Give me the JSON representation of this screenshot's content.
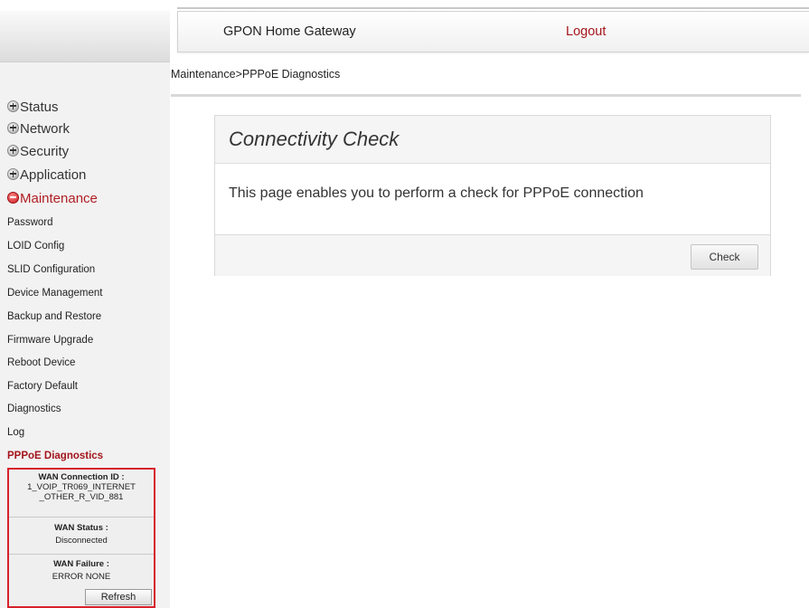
{
  "header": {
    "title": "GPON Home Gateway",
    "logout": "Logout"
  },
  "breadcrumb": "Maintenance>PPPoE Diagnostics",
  "sidebar": {
    "menus": [
      {
        "label": "Status",
        "active": false
      },
      {
        "label": "Network",
        "active": false
      },
      {
        "label": "Security",
        "active": false
      },
      {
        "label": "Application",
        "active": false
      },
      {
        "label": "Maintenance",
        "active": true
      }
    ],
    "submenu": [
      "Password",
      "LOID Config",
      "SLID Configuration",
      "Device Management",
      "Backup and Restore",
      "Firmware Upgrade",
      "Reboot Device",
      "Factory Default",
      "Diagnostics",
      "Log",
      "PPPoE Diagnostics"
    ],
    "active_submenu": "PPPoE Diagnostics"
  },
  "wan_info": {
    "connection_id_label": "WAN Connection ID :",
    "connection_id_line1": "1_VOIP_TR069_INTERNET",
    "connection_id_line2": "_OTHER_R_VID_881",
    "status_label": "WAN Status :",
    "status_value": "Disconnected",
    "failure_label": "WAN Failure :",
    "failure_value": "ERROR NONE",
    "refresh_label": "Refresh"
  },
  "panel": {
    "title": "Connectivity Check",
    "description": "This page enables you to perform a check for PPPoE connection",
    "check_label": "Check"
  },
  "colors": {
    "accent": "#a3161c",
    "highlight_border": "#d8212b"
  },
  "icons": {
    "menu_collapsed": "plus-circle-icon",
    "menu_expanded": "minus-circle-icon"
  }
}
